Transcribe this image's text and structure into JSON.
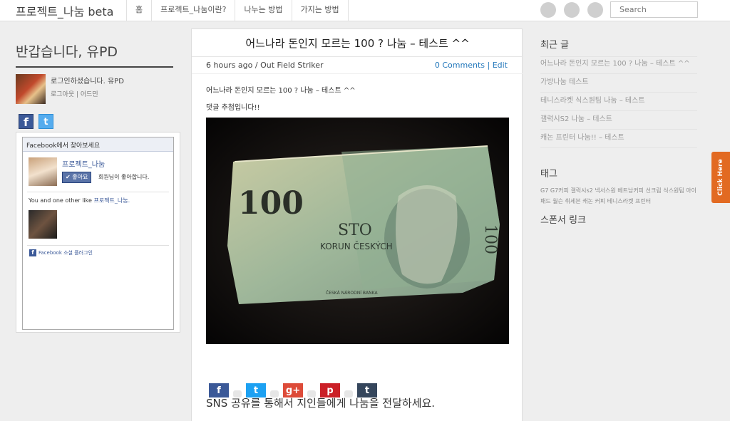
{
  "topbar": {
    "brand": "프로젝트_나눔 beta",
    "nav": [
      "홈",
      "프로젝트_나눔이란?",
      "나누는 방법",
      "가지는 방법"
    ],
    "social_icons": [
      "social-circle-icon",
      "social-circle-icon",
      "social-circle-icon"
    ],
    "search_placeholder": "Search"
  },
  "left": {
    "greeting": "반갑습니다, 유PD",
    "logged_in": "로그인하셨습니다. 유PD",
    "logout_admin": "로그아웃 | 어드민",
    "social": {
      "facebook": "f",
      "twitter": "t"
    },
    "fb_widget": {
      "header": "Facebook에서 찾아보세요",
      "page_name": "프로젝트_나눔",
      "like_label": "✔ 좋아요",
      "like_note": "회원님이 좋아합니다.",
      "friends_prefix": "You and one other like ",
      "friends_page": "프로젝트_나눔.",
      "plugin_icon": "f",
      "plugin_label": "Facebook 소셜 플러그인"
    }
  },
  "post": {
    "title": "어느나라 돈인지 모르는 100 ? 나눔 – 테스트 ^^",
    "meta": "6 hours ago / Out Field Striker",
    "comments": "0 Comments | Edit",
    "body_line1": "어느나라 돈인지 모르는 100 ? 나눔 – 테스트 ^^",
    "body_line2": "댓글 추첨입니다!!",
    "photo_texts": {
      "value": "100",
      "value_rotated": "100",
      "word": "STO",
      "currency": "KORUN ČESKÝCH",
      "bank": "ČESKÁ NÁRODNÍ BANKA"
    },
    "share_heading": "SNS 공유를 통해서 지인들에게 나눔을 전달하세요.",
    "share_buttons": [
      {
        "label": "f",
        "color": "#3b5998"
      },
      {
        "label": "t",
        "color": "#1da1f2"
      },
      {
        "label": "g+",
        "color": "#dd4b39"
      },
      {
        "label": "p",
        "color": "#cb2027"
      },
      {
        "label": "t",
        "color": "#35465c"
      }
    ]
  },
  "right": {
    "recent_heading": "최근 글",
    "recent": [
      "어느나라 돈인지 모르는 100 ? 나눔 – 테스트 ^^",
      "가방나눔 테스트",
      "테니스라켓 식스원팀 나눔 – 테스트",
      "갤럭시S2 나눔 – 테스트",
      "캐논 프린터 나눔!! – 테스트"
    ],
    "tags_heading": "태그",
    "tags": "G7 G7커피 갤럭시s2 넥서스원 베트남커피 선크림 식스원팀 아이패드 월슨 취세븐 캐논 커피 테니스라켓 프린터",
    "sponsor_heading": "스폰서 링크"
  },
  "click_here": "Click Here",
  "colors": {
    "accent_blue": "#2277bb",
    "click_orange": "#e26a22",
    "fb_blue": "#3b5998"
  }
}
